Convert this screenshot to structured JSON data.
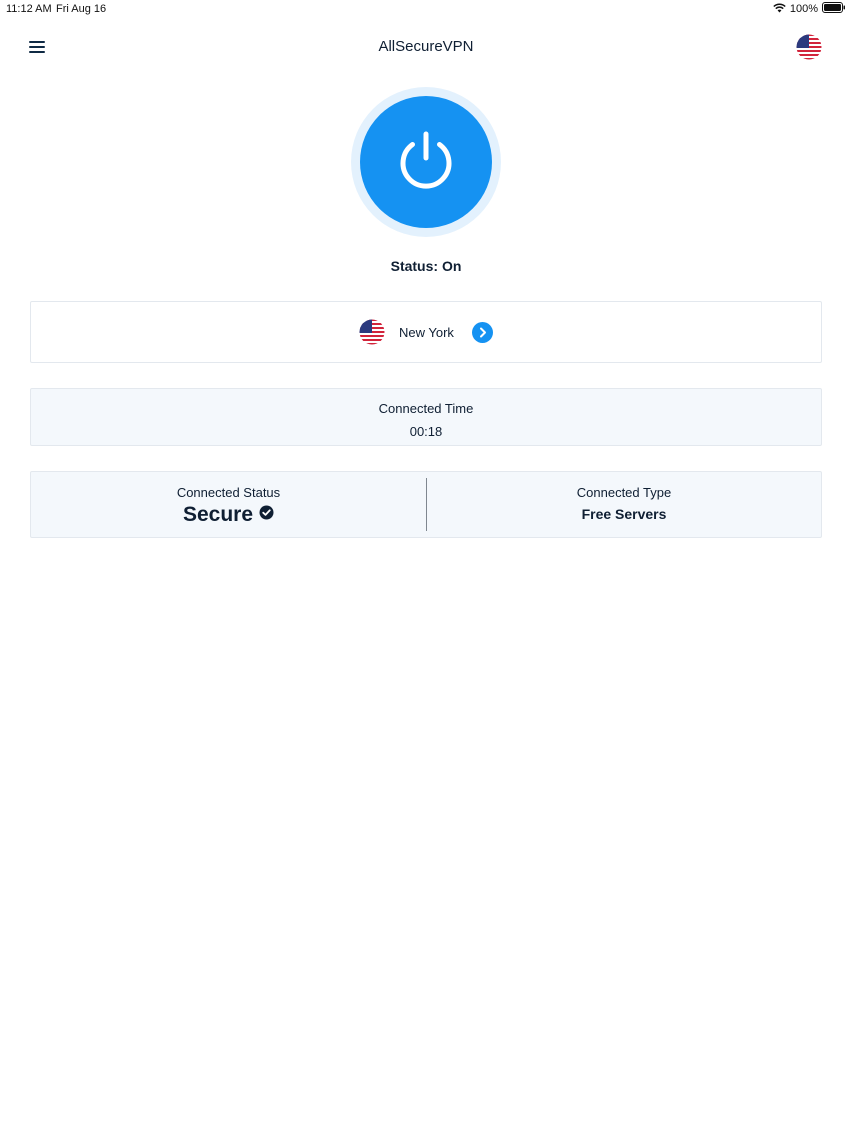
{
  "status_bar": {
    "time": "11:12 AM",
    "date": "Fri Aug 16",
    "battery": "100%",
    "icons": [
      "wifi-icon",
      "battery-icon"
    ]
  },
  "header": {
    "title": "AllSecureVPN",
    "menu_icon": "hamburger-menu-icon",
    "flag_icon": "us-flag-icon"
  },
  "power": {
    "icon": "power-icon",
    "status_text": "Status: On",
    "color": "#1592f2"
  },
  "location": {
    "flag_icon": "us-flag-icon",
    "name": "New York",
    "arrow_icon": "chevron-right-icon"
  },
  "connected_time": {
    "label": "Connected Time",
    "value": "00:18"
  },
  "connection": {
    "status_label": "Connected Status",
    "status_value": "Secure",
    "status_icon": "check-circle-icon",
    "type_label": "Connected Type",
    "type_value": "Free Servers"
  },
  "colors": {
    "accent": "#1592f2",
    "text": "#0f1f33",
    "card_bg": "#f4f8fc"
  }
}
